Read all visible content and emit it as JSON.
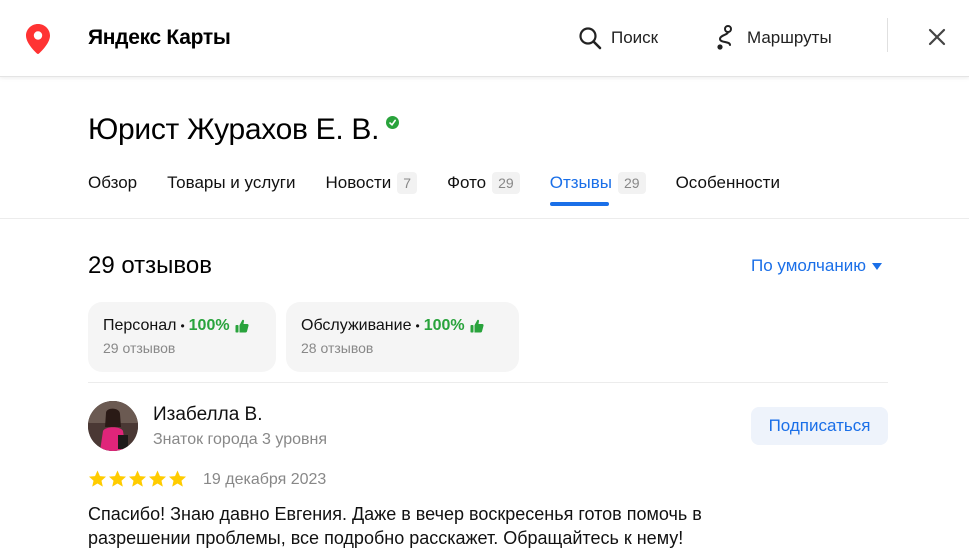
{
  "header": {
    "brand": "Яндекс Карты",
    "search_label": "Поиск",
    "routes_label": "Маршруты"
  },
  "org": {
    "title": "Юрист Журахов Е. В."
  },
  "tabs": [
    {
      "label": "Обзор",
      "count": ""
    },
    {
      "label": "Товары и услуги",
      "count": ""
    },
    {
      "label": "Новости",
      "count": "7"
    },
    {
      "label": "Фото",
      "count": "29"
    },
    {
      "label": "Отзывы",
      "count": "29"
    },
    {
      "label": "Особенности",
      "count": ""
    }
  ],
  "active_tab": "Отзывы",
  "reviews": {
    "count_label": "29 отзывов",
    "sort_label": "По умолчанию",
    "aspects": [
      {
        "name": "Персонал",
        "percent": "100%",
        "sub": "29 отзывов"
      },
      {
        "name": "Обслуживание",
        "percent": "100%",
        "sub": "28 отзывов"
      }
    ],
    "items": [
      {
        "author": "Изабелла В.",
        "level": "Знаток города 3 уровня",
        "subscribe_label": "Подписаться",
        "rating": 5,
        "date": "19 декабря 2023",
        "text": "Спасибо! Знаю давно Евгения. Даже в вечер воскресенья готов помочь в разрешении проблемы, все подробно расскажет. Обращайтесь к нему!"
      }
    ]
  },
  "colors": {
    "accent": "#1a6fe8",
    "green": "#29a33c",
    "star": "#fc0",
    "pin": "#f33"
  }
}
